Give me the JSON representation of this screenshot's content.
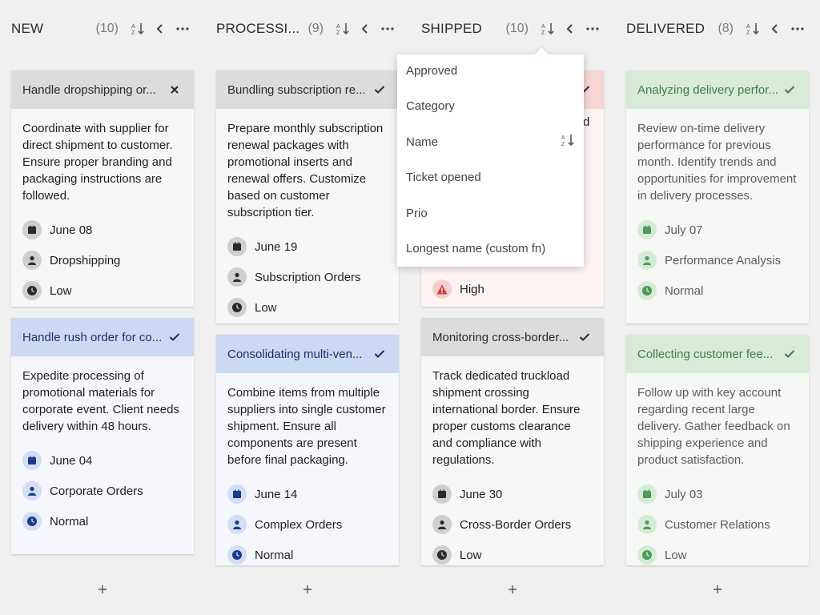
{
  "columns": [
    {
      "title": "NEW",
      "count": "(10)",
      "cards": [
        {
          "title": "Handle dropshipping or...",
          "description": "Coordinate with supplier for direct shipment to customer. Ensure proper branding and packaging instructions are followed.",
          "date": "June 08",
          "category": "Dropshipping",
          "priority": "Low",
          "theme": "gray",
          "status_icon": "close-icon"
        },
        {
          "title": "Handle rush order for co...",
          "description": "Expedite processing of promotional materials for corporate event. Client needs delivery within 48 hours.",
          "date": "June 04",
          "category": "Corporate Orders",
          "priority": "Normal",
          "theme": "blue",
          "status_icon": "check-icon"
        }
      ]
    },
    {
      "title": "PROCESSI...",
      "count": "(9)",
      "cards": [
        {
          "title": "Bundling subscription re...",
          "description": "Prepare monthly subscription renewal packages with promotional inserts and renewal offers. Customize based on customer subscription tier.",
          "date": "June 19",
          "category": "Subscription Orders",
          "priority": "Low",
          "theme": "gray",
          "status_icon": "check-icon"
        },
        {
          "title": "Consolidating multi-ven...",
          "description": "Combine items from multiple suppliers into single customer shipment. Ensure all components are present before final packaging.",
          "date": "June 14",
          "category": "Complex Orders",
          "priority": "Normal",
          "theme": "blue",
          "status_icon": "check-icon"
        }
      ]
    },
    {
      "title": "SHIPPED",
      "count": "(10)",
      "cards": [
        {
          "title": "",
          "description": "",
          "priority": "High",
          "theme": "red",
          "status_icon": "check-icon",
          "partial_text": "d"
        },
        {
          "title": "Monitoring cross-border...",
          "description": "Track dedicated truckload shipment crossing international border. Ensure proper customs clearance and compliance with regulations.",
          "date": "June 30",
          "category": "Cross-Border Orders",
          "priority": "Low",
          "theme": "gray",
          "status_icon": "check-icon"
        }
      ]
    },
    {
      "title": "DELIVERED",
      "count": "(8)",
      "cards": [
        {
          "title": "Analyzing delivery perfor...",
          "description": "Review on-time delivery performance for previous month. Identify trends and opportunities for improvement in delivery processes.",
          "date": "July 07",
          "category": "Performance Analysis",
          "priority": "Normal",
          "theme": "green",
          "status_icon": "check-icon"
        },
        {
          "title": "Collecting customer fee...",
          "description": "Follow up with key account regarding recent large delivery. Gather feedback on shipping experience and product satisfaction.",
          "date": "July 03",
          "category": "Customer Relations",
          "priority": "Low",
          "theme": "green",
          "status_icon": "check-icon"
        }
      ]
    }
  ],
  "sort_menu": {
    "items": [
      {
        "label": "Approved"
      },
      {
        "label": "Category"
      },
      {
        "label": "Name",
        "active": true
      },
      {
        "label": "Ticket opened"
      },
      {
        "label": "Prio"
      },
      {
        "label": "Longest name (custom fn)"
      }
    ]
  },
  "add_button_label": "+",
  "colors": {
    "background": "#f0f0f0",
    "gray_head": "#dcdcde",
    "blue_head": "#ccd9f5",
    "red_head": "#f7d6d3",
    "green_head": "#d8ebd8",
    "blue_icon": "#1b3a8a",
    "green_icon": "#4e9a57",
    "red_icon": "#d23b3b",
    "gray_icon": "#2b2b2b"
  }
}
